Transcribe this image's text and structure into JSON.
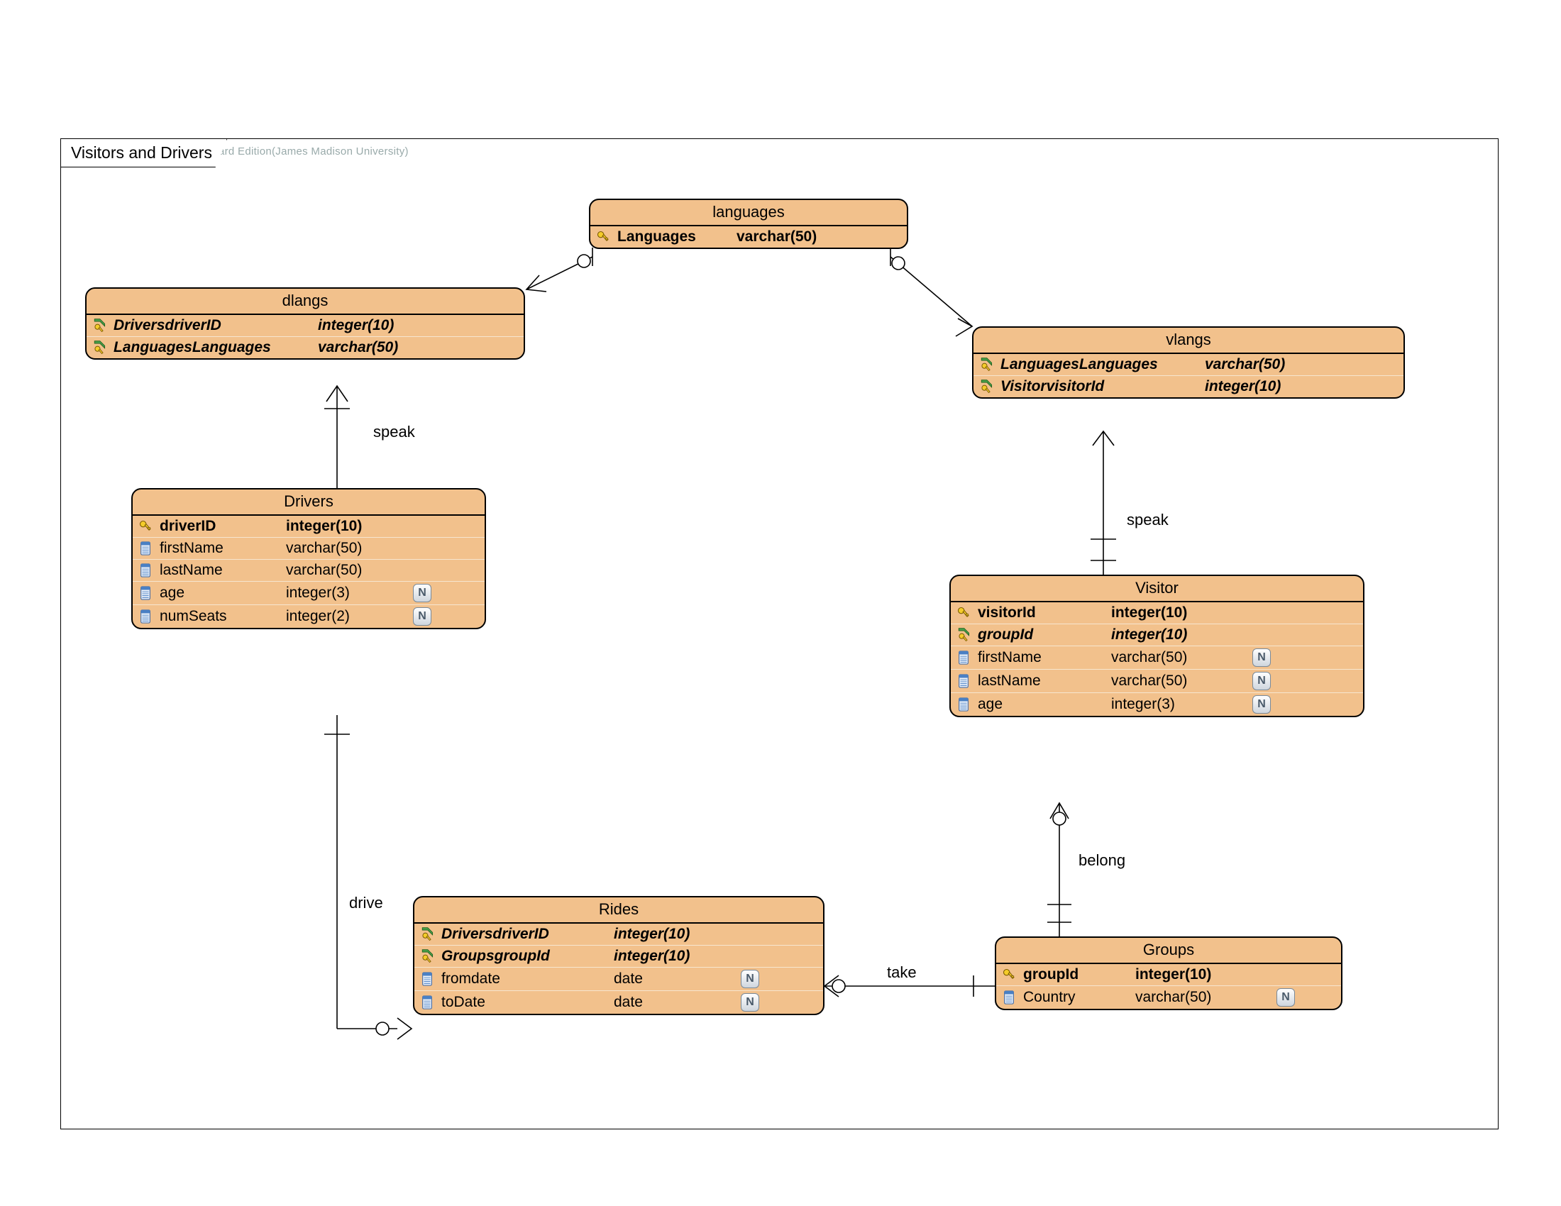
{
  "watermark": "Visual Paradigm for UML Standard Edition(James Madison University)",
  "package_title": "Visitors and Drivers",
  "rel": {
    "speak1": "speak",
    "speak2": "speak",
    "drive": "drive",
    "take": "take",
    "belong": "belong"
  },
  "entities": {
    "languages": {
      "title": "languages",
      "cols": [
        {
          "icon": "pk",
          "name": "Languages",
          "type": "varchar(50)",
          "pk": true
        }
      ]
    },
    "dlangs": {
      "title": "dlangs",
      "cols": [
        {
          "icon": "fk",
          "name": "DriversdriverID",
          "type": "integer(10)",
          "fk": true
        },
        {
          "icon": "fk",
          "name": "LanguagesLanguages",
          "type": "varchar(50)",
          "fk": true
        }
      ]
    },
    "vlangs": {
      "title": "vlangs",
      "cols": [
        {
          "icon": "fk",
          "name": "LanguagesLanguages",
          "type": "varchar(50)",
          "fk": true
        },
        {
          "icon": "fk",
          "name": "VisitorvisitorId",
          "type": "integer(10)",
          "fk": true
        }
      ]
    },
    "drivers": {
      "title": "Drivers",
      "cols": [
        {
          "icon": "pk",
          "name": "driverID",
          "type": "integer(10)",
          "pk": true
        },
        {
          "icon": "col",
          "name": "firstName",
          "type": "varchar(50)"
        },
        {
          "icon": "col",
          "name": "lastName",
          "type": "varchar(50)"
        },
        {
          "icon": "col",
          "name": "age",
          "type": "integer(3)",
          "n": true
        },
        {
          "icon": "col",
          "name": "numSeats",
          "type": "integer(2)",
          "n": true
        }
      ]
    },
    "visitor": {
      "title": "Visitor",
      "cols": [
        {
          "icon": "pk",
          "name": "visitorId",
          "type": "integer(10)",
          "pk": true
        },
        {
          "icon": "fk",
          "name": "groupId",
          "type": "integer(10)",
          "fk": true,
          "it": true
        },
        {
          "icon": "col",
          "name": "firstName",
          "type": "varchar(50)",
          "n": true
        },
        {
          "icon": "col",
          "name": "lastName",
          "type": "varchar(50)",
          "n": true
        },
        {
          "icon": "col",
          "name": "age",
          "type": "integer(3)",
          "n": true
        }
      ]
    },
    "rides": {
      "title": "Rides",
      "cols": [
        {
          "icon": "fk",
          "name": "DriversdriverID",
          "type": "integer(10)",
          "fk": true
        },
        {
          "icon": "fk",
          "name": "GroupsgroupId",
          "type": "integer(10)",
          "fk": true
        },
        {
          "icon": "col",
          "name": "fromdate",
          "type": "date",
          "n": true
        },
        {
          "icon": "col",
          "name": "toDate",
          "type": "date",
          "n": true
        }
      ]
    },
    "groups": {
      "title": "Groups",
      "cols": [
        {
          "icon": "pk",
          "name": "groupId",
          "type": "integer(10)",
          "pk": true
        },
        {
          "icon": "col",
          "name": "Country",
          "type": "varchar(50)",
          "n": true
        }
      ]
    }
  }
}
